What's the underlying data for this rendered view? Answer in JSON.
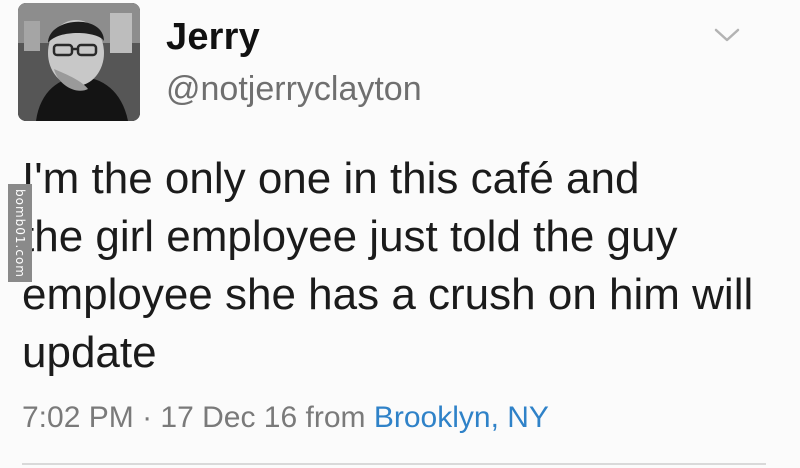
{
  "user": {
    "display_name": "Jerry",
    "handle": "@notjerryclayton",
    "avatar_icon": "profile-photo"
  },
  "tweet": {
    "lines": [
      "I'm the only one in this café and",
      "the girl employee just told the guy",
      "employee she has a crush on him will",
      "update"
    ]
  },
  "meta": {
    "time": "7:02 PM",
    "separator": "·",
    "date": "17 Dec 16",
    "from_label": "from",
    "location": "Brooklyn, NY"
  },
  "watermark": {
    "text": "bomb01.com"
  },
  "colors": {
    "link": "#2f82c8",
    "secondary_text": "#6f6f6f",
    "primary_text": "#1b1b1b"
  }
}
